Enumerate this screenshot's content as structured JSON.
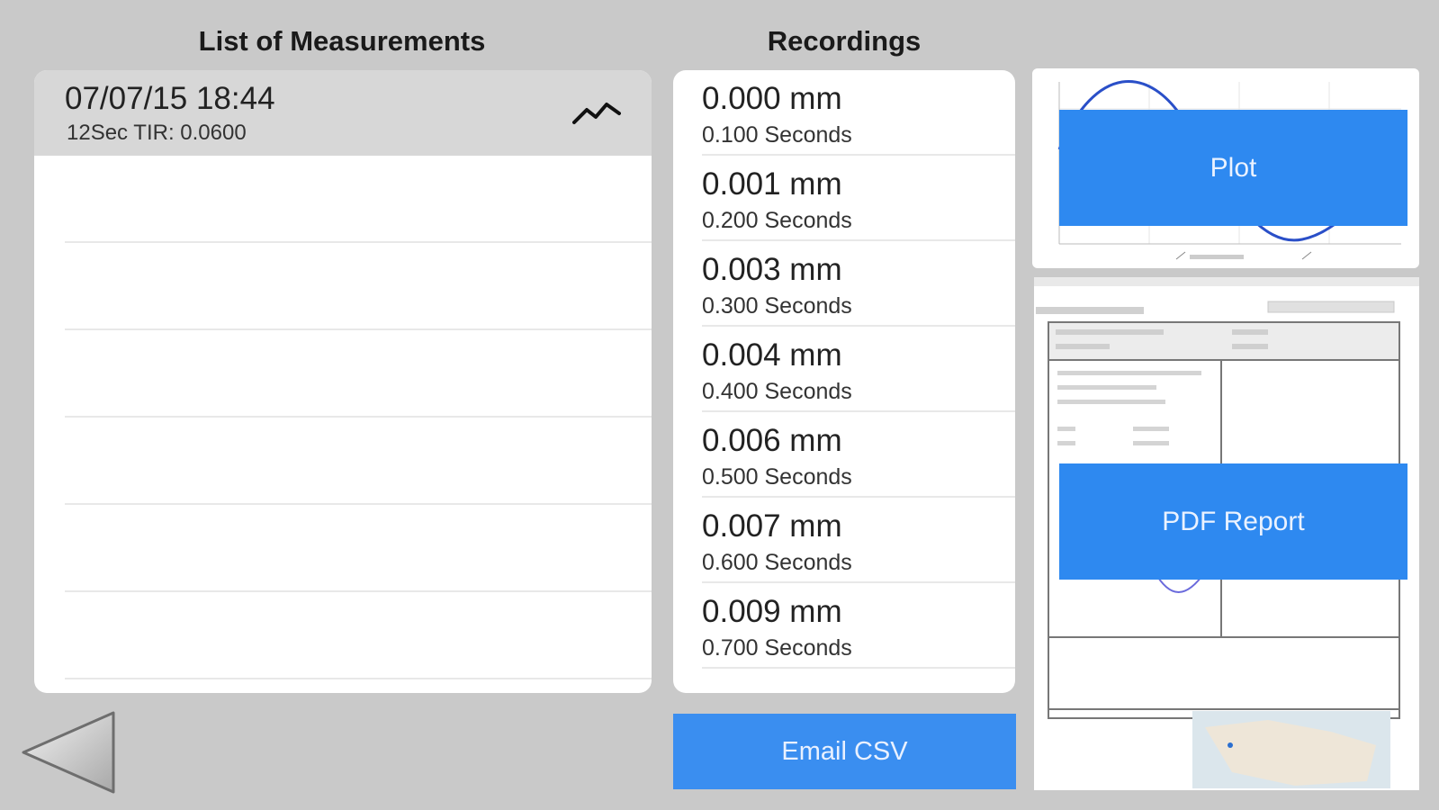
{
  "measurements": {
    "title": "List of Measurements",
    "items": [
      {
        "date": "07/07/15 18:44",
        "subtitle": "12Sec TIR: 0.0600"
      }
    ]
  },
  "recordings": {
    "title": "Recordings",
    "items": [
      {
        "value": "0.000 mm",
        "time": "0.100 Seconds"
      },
      {
        "value": "0.001 mm",
        "time": "0.200 Seconds"
      },
      {
        "value": "0.003 mm",
        "time": "0.300 Seconds"
      },
      {
        "value": "0.004 mm",
        "time": "0.400 Seconds"
      },
      {
        "value": "0.006 mm",
        "time": "0.500 Seconds"
      },
      {
        "value": "0.007 mm",
        "time": "0.600 Seconds"
      },
      {
        "value": "0.009 mm",
        "time": "0.700 Seconds"
      }
    ]
  },
  "buttons": {
    "email": "Email CSV",
    "plot": "Plot",
    "pdf": "PDF Report"
  },
  "icons": {
    "back": "back-arrow-icon",
    "wave": "wave-icon"
  },
  "colors": {
    "accent": "#2e89f0",
    "background": "#c9c9c9",
    "selected_row": "#d7d7d7"
  }
}
